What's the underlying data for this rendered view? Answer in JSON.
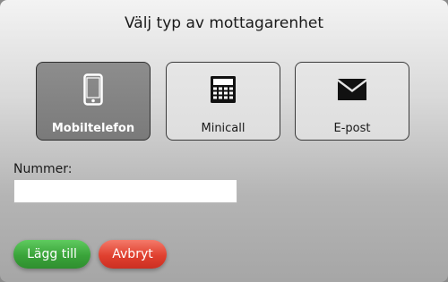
{
  "dialog": {
    "title": "Välj typ av mottagarenhet"
  },
  "device_types": [
    {
      "label": "Mobiltelefon",
      "icon": "mobile-phone-icon",
      "selected": true
    },
    {
      "label": "Minicall",
      "icon": "calculator-icon",
      "selected": false
    },
    {
      "label": "E-post",
      "icon": "envelope-icon",
      "selected": false
    }
  ],
  "number": {
    "label": "Nummer:",
    "value": "",
    "placeholder": ""
  },
  "actions": {
    "add_label": "Lägg till",
    "cancel_label": "Avbryt"
  },
  "colors": {
    "selected_bg": "#858585",
    "add_green": "#3aa33a",
    "cancel_red": "#e0402f"
  }
}
